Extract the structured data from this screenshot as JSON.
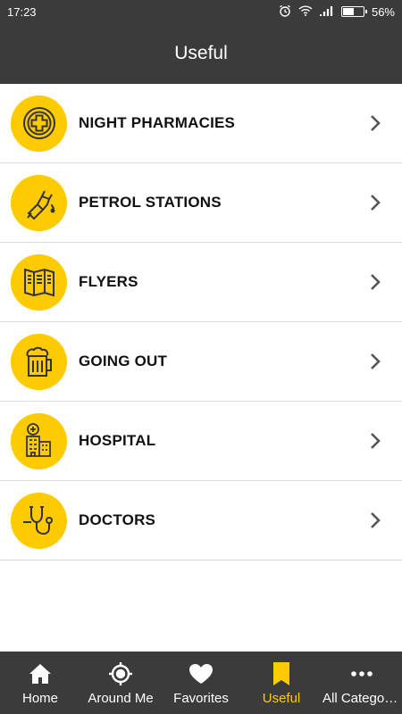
{
  "status_bar": {
    "time": "17:23",
    "battery_text": "56%",
    "battery_level": 0.56
  },
  "header": {
    "title": "Useful"
  },
  "list": {
    "items": [
      {
        "label": "NIGHT PHARMACIES",
        "icon": "pharmacy-cross-icon"
      },
      {
        "label": "PETROL STATIONS",
        "icon": "fuel-nozzle-icon"
      },
      {
        "label": "FLYERS",
        "icon": "flyer-brochure-icon"
      },
      {
        "label": "GOING OUT",
        "icon": "beer-mug-icon"
      },
      {
        "label": "HOSPITAL",
        "icon": "hospital-building-icon"
      },
      {
        "label": "DOCTORS",
        "icon": "stethoscope-icon"
      }
    ]
  },
  "bottom_nav": {
    "tabs": [
      {
        "label": "Home",
        "icon": "home-icon"
      },
      {
        "label": "Around Me",
        "icon": "location-target-icon"
      },
      {
        "label": "Favorites",
        "icon": "heart-icon"
      },
      {
        "label": "Useful",
        "icon": "bookmark-icon",
        "active": true
      },
      {
        "label": "All Categori...",
        "icon": "more-dots-icon"
      }
    ]
  },
  "colors": {
    "accent": "#fecb00",
    "bar_background": "#3b3b3b",
    "icon_stroke": "#333333"
  }
}
